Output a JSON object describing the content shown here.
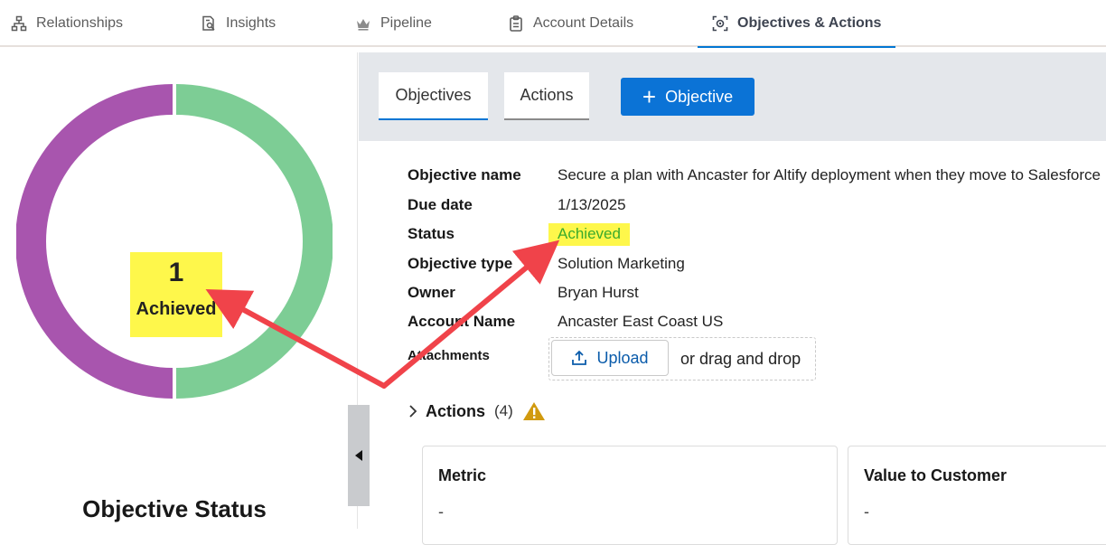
{
  "nav": {
    "tabs": [
      {
        "label": "Relationships",
        "icon": "hierarchy-icon",
        "active": false
      },
      {
        "label": "Insights",
        "icon": "insights-doc-icon",
        "active": false
      },
      {
        "label": "Pipeline",
        "icon": "crown-icon",
        "active": false
      },
      {
        "label": "Account Details",
        "icon": "clipboard-icon",
        "active": false
      },
      {
        "label": "Objectives & Actions",
        "icon": "target-icon",
        "active": true
      }
    ]
  },
  "left_panel": {
    "achieved_count": "1",
    "achieved_label": "Achieved",
    "title": "Objective Status",
    "donut": {
      "segments": [
        {
          "color": "#7dcd95",
          "fraction": 0.5
        },
        {
          "color": "#a855ae",
          "fraction": 0.5
        }
      ]
    }
  },
  "subtabs": {
    "objectives": "Objectives",
    "actions": "Actions",
    "add_objective": "Objective"
  },
  "detail": {
    "objective_name_label": "Objective name",
    "objective_name": "Secure a plan with Ancaster for Altify deployment when they move to Salesforce",
    "due_date_label": "Due date",
    "due_date": "1/13/2025",
    "status_label": "Status",
    "status": "Achieved",
    "objective_type_label": "Objective type",
    "objective_type": "Solution Marketing",
    "owner_label": "Owner",
    "owner": "Bryan Hurst",
    "account_name_label": "Account Name",
    "account_name": "Ancaster East Coast US",
    "attachments_label": "Attachments",
    "upload_label": "Upload",
    "drop_text": "or drag and drop"
  },
  "actions_section": {
    "title": "Actions",
    "count": "(4)"
  },
  "cards": {
    "metric_title": "Metric",
    "metric_value": "-",
    "value_title": "Value to Customer",
    "value_value": "-"
  },
  "colors": {
    "accent": "#0176d3",
    "highlight": "#fef74b",
    "status_green": "#3aab2c",
    "annotation_arrow": "#f0434a"
  }
}
